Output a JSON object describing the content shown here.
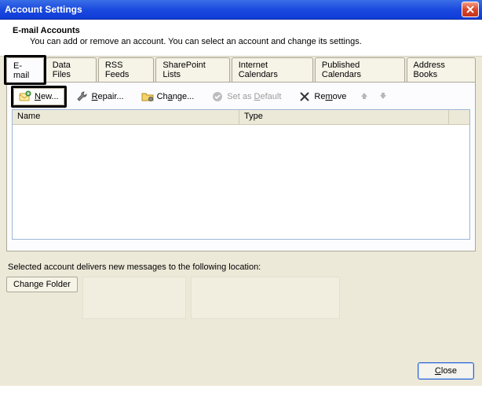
{
  "titlebar": {
    "title": "Account Settings"
  },
  "header": {
    "title": "E-mail Accounts",
    "subtitle": "You can add or remove an account. You can select an account and change its settings."
  },
  "tabs": [
    {
      "label": "E-mail",
      "active": true
    },
    {
      "label": "Data Files"
    },
    {
      "label": "RSS Feeds"
    },
    {
      "label": "SharePoint Lists"
    },
    {
      "label": "Internet Calendars"
    },
    {
      "label": "Published Calendars"
    },
    {
      "label": "Address Books"
    }
  ],
  "toolbar": {
    "new": {
      "label": "New...",
      "accel": "N"
    },
    "repair": {
      "label": "Repair...",
      "accel": "R"
    },
    "change": {
      "label": "Change...",
      "accel": "a"
    },
    "default": {
      "label": "Set as Default",
      "accel": "D",
      "disabled": true
    },
    "remove": {
      "label": "Remove",
      "accel": "m"
    },
    "up": {
      "disabled": true
    },
    "down": {
      "disabled": true
    }
  },
  "list": {
    "columns": {
      "name": "Name",
      "type": "Type"
    },
    "rows": []
  },
  "lower": {
    "text": "Selected account delivers new messages to the following location:",
    "changeFolder": "Change Folder"
  },
  "footer": {
    "close": "Close",
    "accel": "C"
  },
  "icons": {
    "close": "x-icon",
    "new": "mail-new-icon",
    "repair": "wrench-icon",
    "change": "folder-gear-icon",
    "default": "check-circle-icon",
    "remove": "delete-x-icon",
    "up": "arrow-up-icon",
    "down": "arrow-down-icon"
  },
  "colors": {
    "titlebar": "#1b4adf",
    "panel": "#ece9d8",
    "border": "#aca899",
    "highlight": "#000000"
  }
}
